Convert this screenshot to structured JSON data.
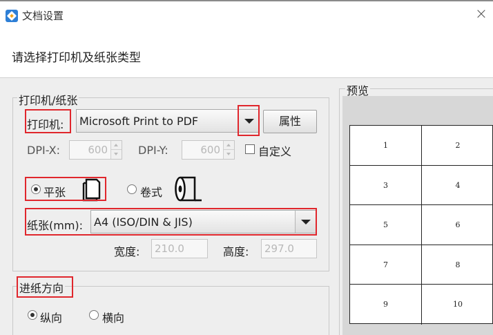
{
  "window": {
    "title": "文档设置",
    "close_glyph": "×"
  },
  "header": {
    "instruction": "请选择打印机及纸张类型"
  },
  "printer_group": {
    "legend": "打印机/纸张",
    "printer_label": "打印机:",
    "printer_value": "Microsoft Print to PDF",
    "properties_button": "属性",
    "dpi_x_label": "DPI-X:",
    "dpi_x_value": "600",
    "dpi_y_label": "DPI-Y:",
    "dpi_y_value": "600",
    "custom_label": "自定义",
    "custom_checked": false,
    "paper_type_flat_label": "平张",
    "paper_type_roll_label": "卷式",
    "paper_type_selected": "平张",
    "paper_label": "纸张(mm):",
    "paper_value": "A4 (ISO/DIN & JIS)",
    "width_label": "宽度:",
    "width_value": "210.0",
    "height_label": "高度:",
    "height_value": "297.0"
  },
  "feed_group": {
    "legend": "进纸方向",
    "portrait_label": "纵向",
    "landscape_label": "横向",
    "selected": "纵向"
  },
  "preview": {
    "legend": "预览",
    "cells": [
      "1",
      "2",
      "3",
      "4",
      "5",
      "6",
      "7",
      "8",
      "9",
      "10"
    ]
  },
  "colors": {
    "highlight": "#e0262c",
    "accent": "#2e7fd6"
  }
}
